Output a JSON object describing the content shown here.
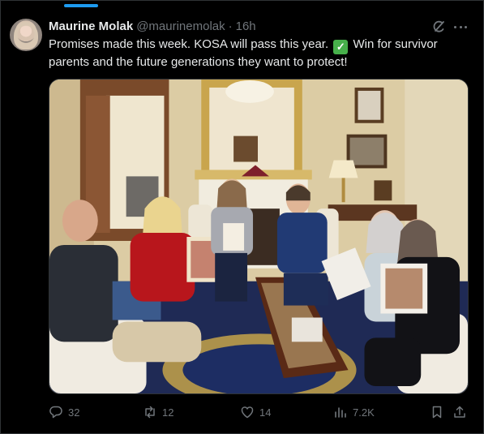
{
  "tweet": {
    "author_name": "Maurine Molak",
    "handle": "@maurinemolak",
    "separator": "·",
    "time": "16h",
    "text_before_check": "Promises made this week. KOSA will pass this year.",
    "check_glyph": "✓",
    "text_after_check": " Win for survivor parents and the future generations they want to protect!"
  },
  "media": {
    "alt": "Group photo of parents holding photos of their children with a congressman in an office"
  },
  "actions": {
    "reply_count": "32",
    "repost_count": "12",
    "like_count": "14",
    "view_count": "7.2K"
  },
  "icons": {
    "grok": "grok-icon",
    "more": "more-dots-icon",
    "reply": "reply-icon",
    "repost": "repost-icon",
    "like": "heart-icon",
    "views": "views-bar-chart-icon",
    "bookmark": "bookmark-icon",
    "share": "share-icon"
  },
  "colors": {
    "background": "#000000",
    "text_primary": "#e7e9ea",
    "text_secondary": "#71767b",
    "accent": "#1d9bf0",
    "check_emoji": "#47b04b"
  }
}
